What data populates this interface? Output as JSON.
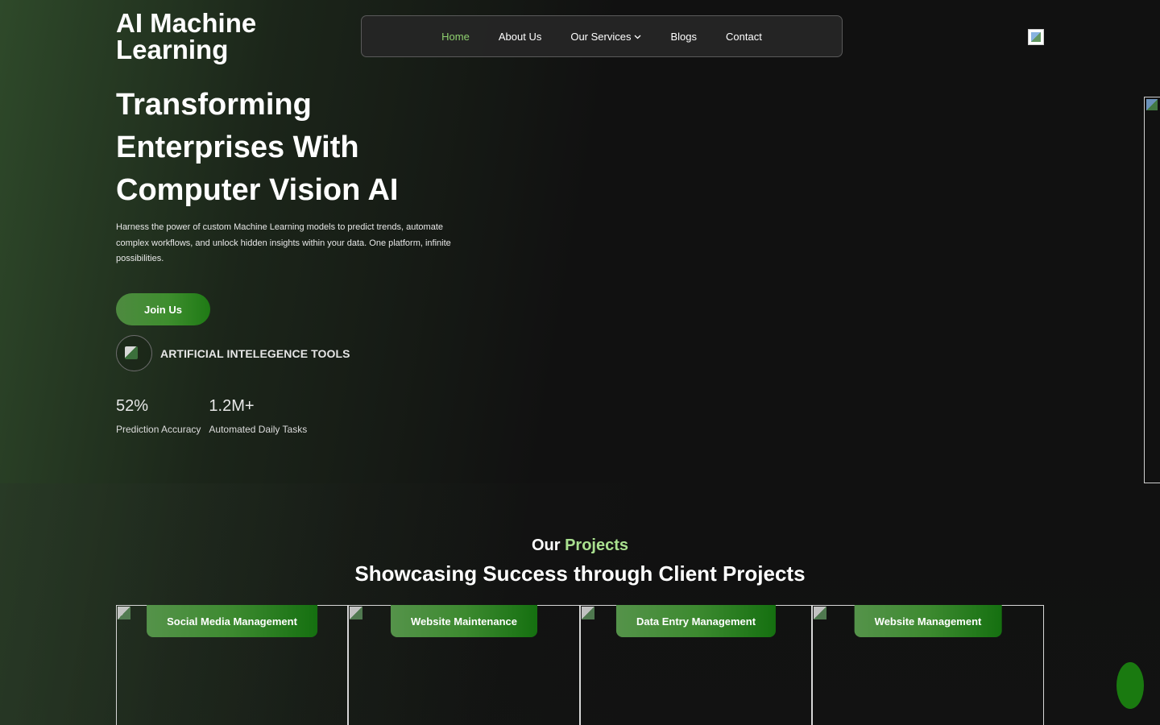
{
  "brand": {
    "name": "AI Machine Learning"
  },
  "nav": {
    "items": [
      {
        "label": "Home",
        "active": true
      },
      {
        "label": "About Us"
      },
      {
        "label": "Our Services",
        "has_dropdown": true
      },
      {
        "label": "Blogs"
      },
      {
        "label": "Contact"
      }
    ],
    "dropdown_icon": "chevron-down-icon"
  },
  "hero": {
    "title": "Transforming Enterprises With Computer Vision AI",
    "description": "Harness the power of custom Machine Learning models to predict trends, automate complex workflows, and unlock hidden insights within your data. One platform, infinite possibilities.",
    "cta_label": "Join Us",
    "tools_label": "ARTIFICIAL INTELEGENCE TOOLS",
    "stats": [
      {
        "value": "52%",
        "label": "Prediction Accuracy"
      },
      {
        "value": "1.2M+",
        "label": "Automated Daily Tasks"
      }
    ]
  },
  "projects": {
    "eyebrow_prefix": "Our",
    "eyebrow_accent": "Projects",
    "title": "Showcasing Success through Client Projects",
    "cards": [
      {
        "tag": "Social Media Management"
      },
      {
        "tag": "Website Maintenance"
      },
      {
        "tag": "Data Entry Management"
      },
      {
        "tag": "Website Management"
      }
    ]
  },
  "colors": {
    "accent_green": "#8fd16f",
    "button_green": "#3e8e2e",
    "background": "#111111"
  }
}
